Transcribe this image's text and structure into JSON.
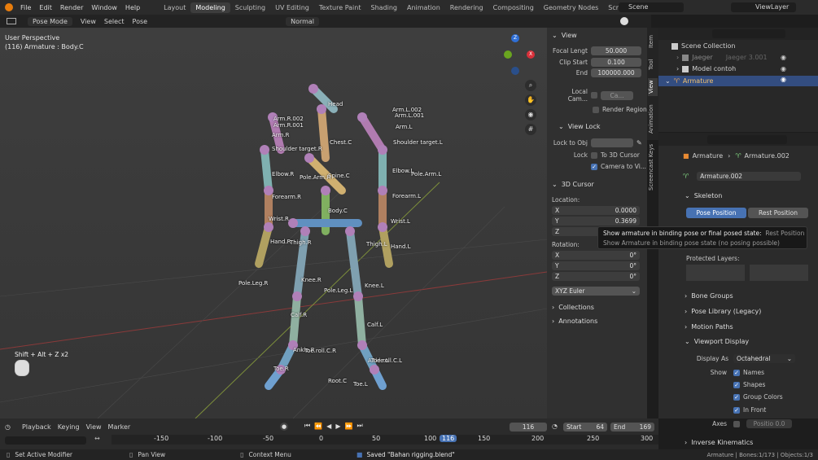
{
  "menu": [
    "File",
    "Edit",
    "Render",
    "Window",
    "Help"
  ],
  "workspaces": [
    "Layout",
    "Modeling",
    "Sculpting",
    "UV Editing",
    "Texture Paint",
    "Shading",
    "Animation",
    "Rendering",
    "Compositing",
    "Geometry Nodes",
    "Scripting"
  ],
  "active_workspace": "Modeling",
  "scene": "Scene",
  "view_layer": "ViewLayer",
  "header": {
    "mode": "Pose Mode",
    "view": "View",
    "select": "Select",
    "pose": "Pose",
    "orientation": "Normal"
  },
  "viewport": {
    "perspective": "User Perspective",
    "object": "(116) Armature : Body.C",
    "shortcut": "Shift + Alt + Z x2",
    "bone_labels": [
      "Head",
      "Arm.R.002",
      "Arm.R.001",
      "Arm.L.002",
      "Arm.L.001",
      "Arm.R",
      "Arm.L",
      "Chest.C",
      "Shoulder target.R",
      "Shoulder target.L",
      "Elbow.R",
      "Pole.Arm.R",
      "Spine.C",
      "Elbow.L",
      "Pole.Arm.L",
      "Forearm.R",
      "Forearm.L",
      "Wrist.R",
      "Body.C",
      "Wrist.L",
      "Hand.R",
      "Thigh.R",
      "Thigh.L",
      "Hand.L",
      "Pole.Leg.R",
      "Knee.R",
      "Pole.Leg.L",
      "Knee.L",
      "Calf.R",
      "Calf.L",
      "Ankle.R",
      "Ankle.L",
      "Toe.roll.C.R",
      "Toe.roll.C.L",
      "Root.C",
      "Toe.R",
      "Toe.L"
    ]
  },
  "npanel": {
    "view_title": "View",
    "focal_label": "Focal Lengt",
    "focal": "50.000",
    "clip_start_label": "Clip Start",
    "clip_start": "0.100",
    "end_label": "End",
    "clip_end": "100000.000",
    "local_cam": "Local Cam...",
    "render_region": "Render Region",
    "view_lock": "View Lock",
    "lock_to_obj": "Lock to Obj",
    "lock": "Lock",
    "to_3d_cursor": "To 3D Cursor",
    "camera_to_view": "Camera to Vi...",
    "cursor_title": "3D Cursor",
    "location": "Location:",
    "loc": [
      {
        "axis": "X",
        "value": "0.0000"
      },
      {
        "axis": "Y",
        "value": "0.3699"
      },
      {
        "axis": "Z",
        "value": ""
      }
    ],
    "rotation": "Rotation:",
    "rot": [
      {
        "axis": "X",
        "value": "0°"
      },
      {
        "axis": "Y",
        "value": "0°"
      },
      {
        "axis": "Z",
        "value": "0°"
      }
    ],
    "rot_mode": "XYZ Euler",
    "collections": "Collections",
    "annotations": "Annotations"
  },
  "ntabs": [
    "Item",
    "Tool",
    "View",
    "Animation",
    "Screencast Keys"
  ],
  "outliner": {
    "root": "Scene Collection",
    "items": [
      "Jaeger",
      "Model contoh",
      "Armature"
    ],
    "jaeger_extra": "Jaeger 3.001"
  },
  "props": {
    "breadcrumb_obj": "Armature",
    "breadcrumb_data": "Armature.002",
    "data_name": "Armature.002",
    "skeleton": "Skeleton",
    "pose_position": "Pose Position",
    "rest_position": "Rest Position",
    "protected_layers": "Protected Layers:",
    "bone_groups": "Bone Groups",
    "pose_library": "Pose Library (Legacy)",
    "motion_paths": "Motion Paths",
    "viewport_display": "Viewport Display",
    "display_as_label": "Display As",
    "display_as": "Octahedral",
    "show": "Show",
    "names": "Names",
    "shapes": "Shapes",
    "group_colors": "Group Colors",
    "in_front": "In Front",
    "axes": "Axes",
    "position_label": "Positio",
    "position": "0.0",
    "inverse_kinematics": "Inverse Kinematics"
  },
  "tooltip": {
    "line1": "Show armature in binding pose or final posed state:",
    "line1b": "Rest Position",
    "line2": "Show Armature in binding pose state (no posing possible)"
  },
  "timeline": {
    "playback": "Playback",
    "keying": "Keying",
    "view": "View",
    "marker": "Marker",
    "frame": "116",
    "start_label": "Start",
    "start": "64",
    "end_label": "End",
    "end": "169",
    "ruler": [
      "-150",
      "-100",
      "-50",
      "0",
      "50",
      "100",
      "116",
      "150",
      "200",
      "250",
      "300"
    ]
  },
  "status": {
    "left": "Set Active Modifier",
    "mid": "Pan View",
    "ctx": "Context Menu",
    "saved": "Saved \"Bahan rigging.blend\"",
    "right": "Armature | Bones:1/173 | Objects:1/3"
  }
}
